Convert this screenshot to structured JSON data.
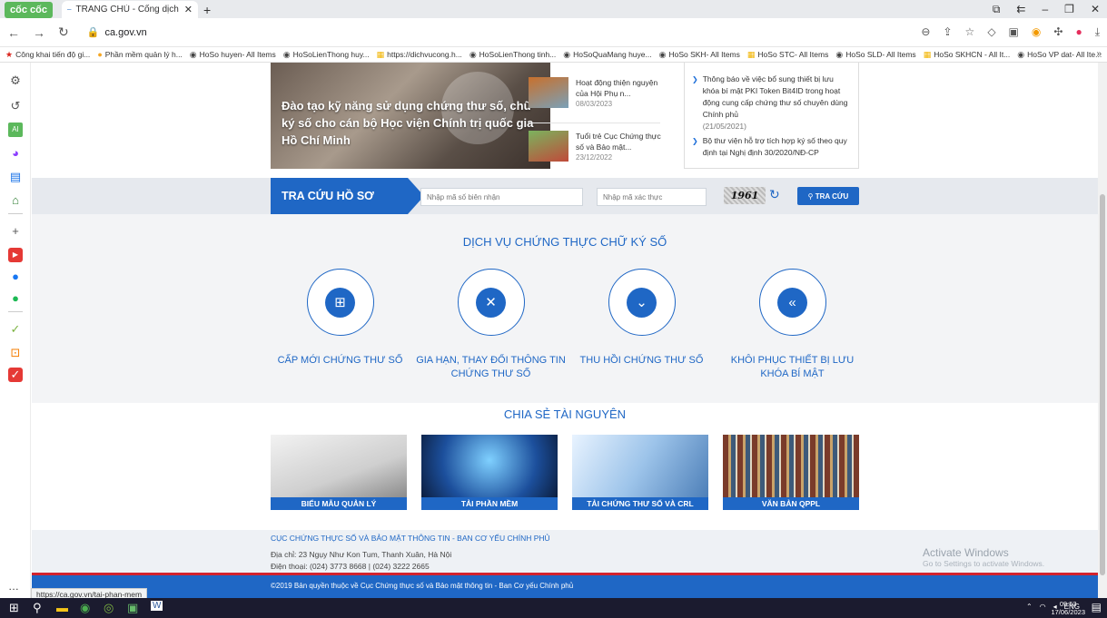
{
  "browser": {
    "brand": "cốc cốc",
    "tab_title": "TRANG CHỦ - Cổng dịch vụ",
    "url": "ca.gov.vn",
    "bookmarks": [
      "Công khai tiến độ gi...",
      "Phần mềm quản lý h...",
      "HoSo huyen- All Items",
      "HoSoLienThong huy...",
      "https://dichvucong.h...",
      "HoSoLienThong tinh...",
      "HoSoQuaMang huye...",
      "HoSo SKH- All Items",
      "HoSo STC- All Items",
      "HoSo SLD- All Items",
      "HoSo SKHCN - All It...",
      "HoSo VP dat- All Ite..."
    ],
    "status_url": "https://ca.gov.vn/tai-phan-mem"
  },
  "hero": {
    "caption": "Đào tạo kỹ năng sử dụng chứng thư số, chữ ký số cho cán bộ Học viện Chính trị quốc gia Hồ Chí Minh"
  },
  "news": [
    {
      "title": "Hoạt động thiện nguyện của Hội Phụ n...",
      "date": "08/03/2023"
    },
    {
      "title": "Tuổi trẻ Cục Chứng thực số và Bảo mật...",
      "date": "23/12/2022"
    }
  ],
  "notices": [
    {
      "title": "Thông báo về việc bổ sung thiết bị lưu khóa bí mật PKI Token Bit4ID trong hoạt động cung cấp chứng thư số chuyên dùng Chính phủ",
      "date": "(21/05/2021)"
    },
    {
      "title": "Bộ thư viện hỗ trợ tích hợp ký số theo quy định tại Nghị định 30/2020/NĐ-CP",
      "date": ""
    }
  ],
  "search": {
    "label": "TRA CỨU HỒ SƠ",
    "receipt_placeholder": "Nhập mã số biên nhận",
    "captcha_placeholder": "Nhập mã xác thực",
    "captcha_text": "1961",
    "button": "TRA CỨU"
  },
  "services": {
    "title": "DỊCH VỤ CHỨNG THỰC CHỮ KÝ SỐ",
    "items": [
      {
        "label": "CẤP MỚI CHỨNG THƯ SỐ",
        "icon": "calendar-plus-icon",
        "glyph": "⊞"
      },
      {
        "label": "GIA HẠN, THAY ĐỔI THÔNG TIN CHỨNG THƯ SỐ",
        "icon": "expand-arrows-icon",
        "glyph": "✕"
      },
      {
        "label": "THU HỒI CHỨNG THƯ SỐ",
        "icon": "double-chevron-down-icon",
        "glyph": "⌄"
      },
      {
        "label": "KHÔI PHỤC THIẾT BỊ LƯU KHÓA BÍ MẬT",
        "icon": "reply-all-icon",
        "glyph": "«"
      }
    ]
  },
  "resources": {
    "title": "CHIA SẺ TÀI NGUYÊN",
    "items": [
      {
        "label": "BIỂU MẪU QUẢN LÝ"
      },
      {
        "label": "TẢI PHẦN MỀM"
      },
      {
        "label": "TẢI CHỨNG THƯ SỐ VÀ CRL"
      },
      {
        "label": "VĂN BẢN QPPL"
      }
    ]
  },
  "footer": {
    "org": "CỤC CHỨNG THỰC SỐ VÀ BẢO MẬT THÔNG TIN - BAN CƠ YẾU CHÍNH PHỦ",
    "address": "Địa chỉ: 23 Ngụy Như Kon Tum, Thanh Xuân, Hà Nội",
    "phone": "Điện thoại: (024) 3773 8668 | (024) 3222 2665",
    "activate": "Activate Windows",
    "activate_sub": "Go to Settings to activate Windows.",
    "copyright": "©2019 Bản quyền thuộc về Cục Chứng thực số và Bảo mật thông tin - Ban Cơ yếu Chính phủ"
  },
  "taskbar": {
    "lang": "ENG",
    "time": "09:53",
    "date": "17/06/2023"
  },
  "colors": {
    "primary": "#1f67c5",
    "accent_red": "#d3232d",
    "footer_bg": "#eef1f5"
  }
}
